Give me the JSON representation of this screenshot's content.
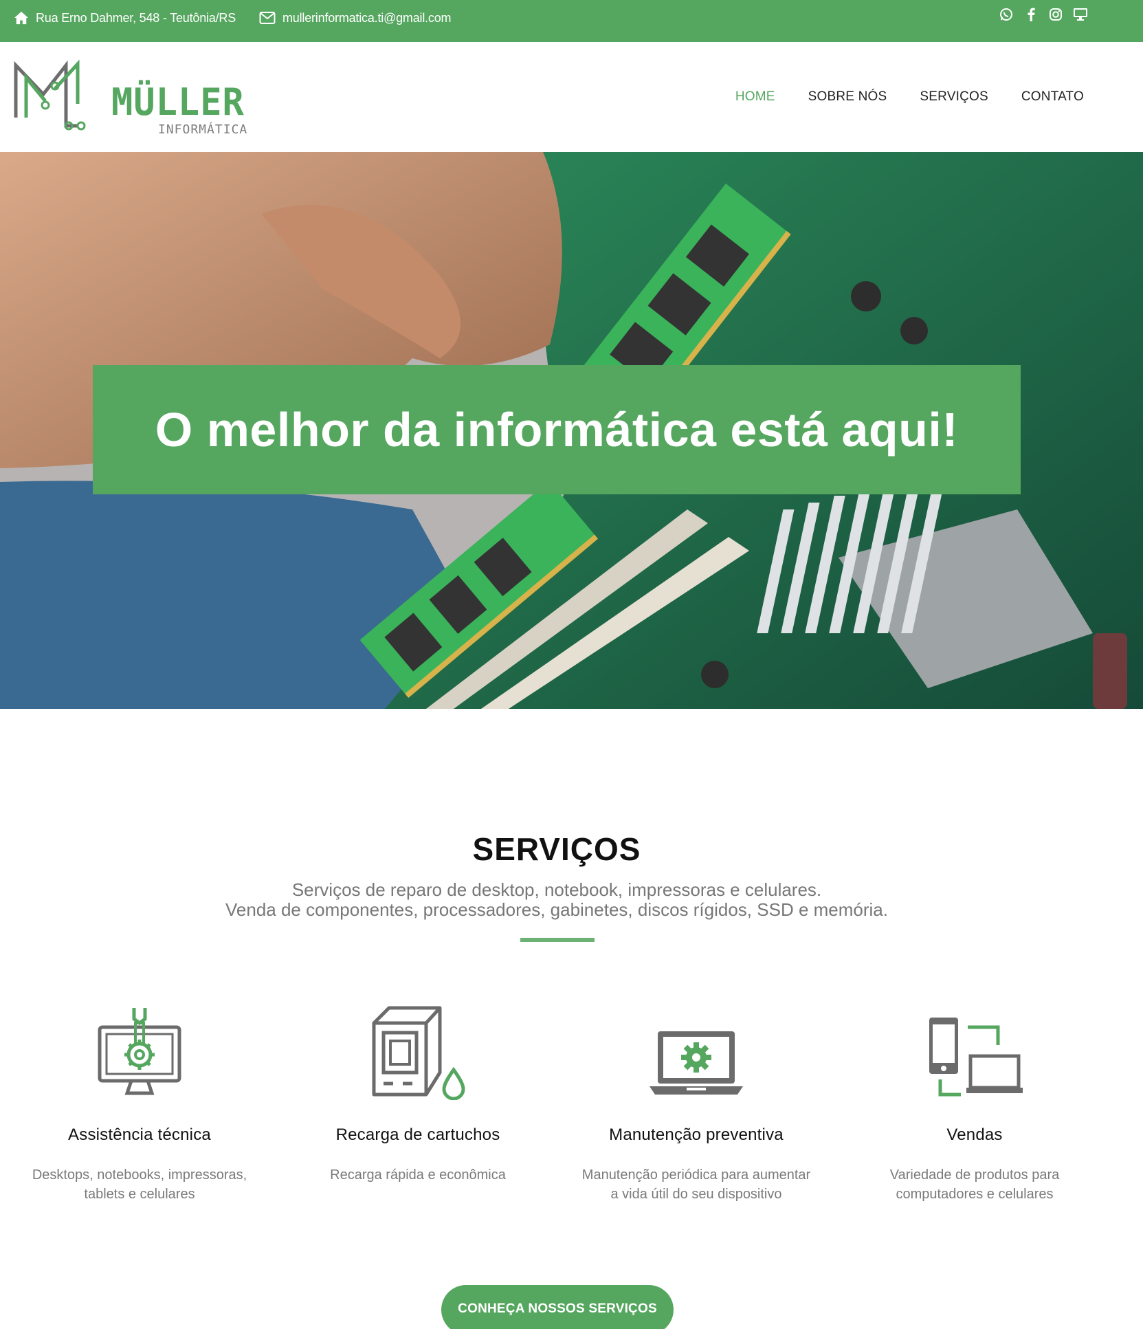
{
  "topbar": {
    "address": "Rua Erno Dahmer, 548 - Teutônia/RS",
    "email": "mullerinformatica.ti@gmail.com",
    "social_icons": [
      "whatsapp-icon",
      "facebook-icon",
      "instagram-icon",
      "monitor-icon"
    ]
  },
  "brand": {
    "name": "MÜLLER",
    "tagline": "INFORMÁTICA",
    "color": "#55a65f"
  },
  "nav": {
    "items": [
      {
        "label": "HOME",
        "active": true
      },
      {
        "label": "SOBRE NÓS",
        "active": false
      },
      {
        "label": "SERVIÇOS",
        "active": false
      },
      {
        "label": "CONTATO",
        "active": false
      }
    ]
  },
  "hero": {
    "headline": "O melhor da informática está aqui!"
  },
  "services": {
    "title": "SERVIÇOS",
    "description_line1": "Serviços de reparo de desktop, notebook, impressoras e celulares.",
    "description_line2": "Venda de componentes, processadores, gabinetes, discos rígidos, SSD e memória.",
    "items": [
      {
        "icon": "monitor-wrench-icon",
        "title": "Assistência técnica",
        "line1": "Desktops, notebooks, impressoras,",
        "line2": "tablets e celulares"
      },
      {
        "icon": "cartridge-ink-icon",
        "title": "Recarga de cartuchos",
        "line1": "Recarga rápida e econômica",
        "line2": ""
      },
      {
        "icon": "laptop-gear-icon",
        "title": "Manutenção preventiva",
        "line1": "Manutenção periódica para aumentar",
        "line2": "a vida útil do seu dispositivo"
      },
      {
        "icon": "devices-icon",
        "title": "Vendas",
        "line1": "Variedade de produtos para",
        "line2": "computadores e celulares"
      }
    ],
    "cta_label": "CONHEÇA NOSSOS SERVIÇOS"
  },
  "colors": {
    "accent": "#55a65f",
    "icon_gray": "#6b6b6b",
    "text_muted": "#7a7a7a"
  }
}
